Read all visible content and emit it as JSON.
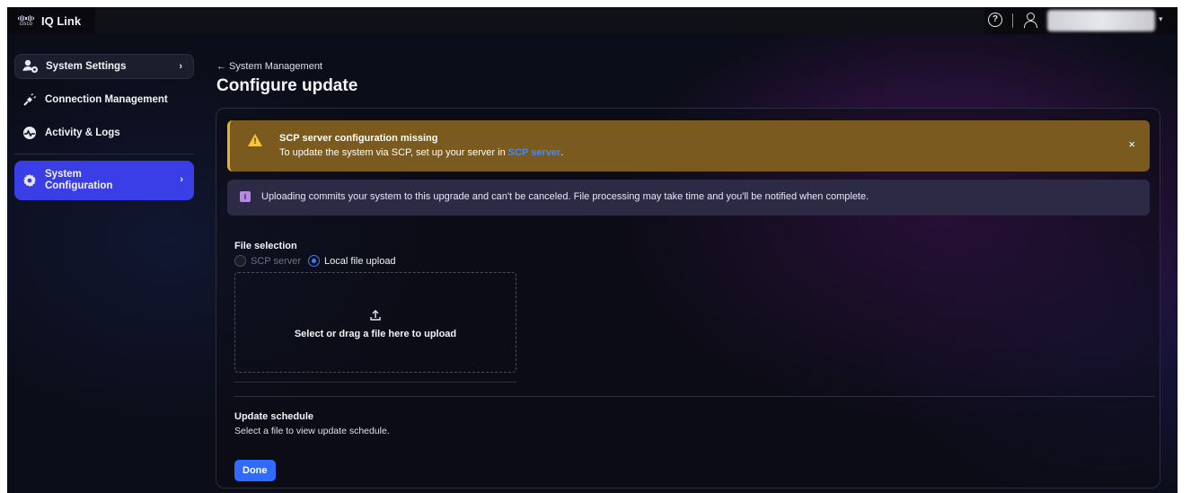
{
  "header": {
    "brand_word": "cisco",
    "app_name": "IQ Link",
    "help_glyph": "?",
    "icons": [
      "help-icon",
      "user-icon",
      "chevron-down-icon"
    ]
  },
  "sidebar": {
    "items": [
      {
        "label": "System Settings",
        "icon": "user-settings-icon",
        "chevron": "›"
      },
      {
        "label": "Connection Management",
        "icon": "plug-icon"
      },
      {
        "label": "Activity & Logs",
        "icon": "activity-icon"
      },
      {
        "label": "System\nConfiguration",
        "icon": "gear-icon",
        "chevron": "›",
        "active": true
      }
    ]
  },
  "main": {
    "breadcrumb": "← System Management",
    "title": "Configure update",
    "warning": {
      "title": "SCP server configuration missing",
      "message": "To update the system via SCP, set up your server in ",
      "link": "SCP server",
      "suffix": ".",
      "close": "×"
    },
    "info": {
      "icon_glyph": "i",
      "message": "Uploading commits your system to this upgrade and can't be canceled. File processing may take time and you'll be notified when complete."
    },
    "file_selection": {
      "label": "File selection",
      "options": [
        {
          "label": "SCP server",
          "selected": false,
          "disabled": true
        },
        {
          "label": "Local file upload",
          "selected": true
        }
      ],
      "dropzone_text": "Select or drag a file here to upload"
    },
    "update_schedule": {
      "title": "Update schedule",
      "subtitle": "Select a file to view update schedule."
    },
    "done_label": "Done"
  },
  "colors": {
    "accent": "#3a3ee6",
    "primary_button": "#2f6bff",
    "warning_bg": "#7a5a1f",
    "warning_border": "#e7b12d",
    "info_bg": "#2d2a45"
  }
}
